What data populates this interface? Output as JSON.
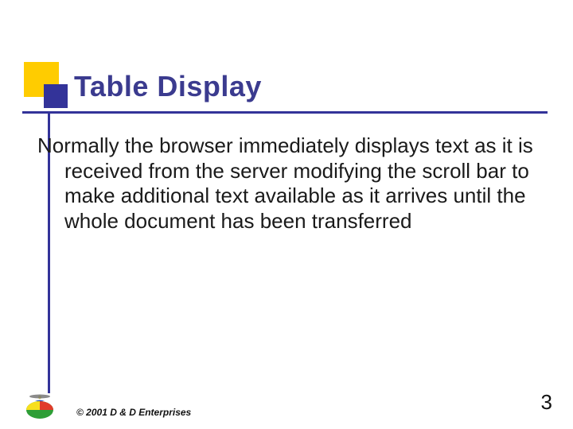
{
  "header": {
    "title": "Table Display"
  },
  "body": {
    "paragraph": "Normally the browser immediately displays text as it is received from the server modifying the scroll bar to make additional text available as it arrives until the whole document has been transferred"
  },
  "footer": {
    "copyright": "© 2001 D & D Enterprises",
    "page_number": "3"
  },
  "colors": {
    "accent_yellow": "#ffcc00",
    "accent_blue": "#333399"
  }
}
